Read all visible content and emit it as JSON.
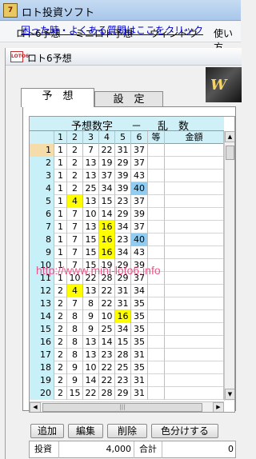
{
  "app": {
    "title": "ロト投資ソフト",
    "icon_text": "7"
  },
  "menu": [
    "ロト6予想",
    "ミニロト予想",
    "ウィンドウ",
    "使い方"
  ],
  "child": {
    "title": "ロト6予想",
    "icon_text": "LOTO6",
    "help_link": "困った時・よくある質問はここをクリック",
    "banner_text": "W"
  },
  "tabs": [
    "予　想",
    "設　定"
  ],
  "grid": {
    "title_left": "予想数字",
    "title_dash": "－",
    "title_right": "乱　数",
    "headers": [
      "1",
      "2",
      "3",
      "4",
      "5",
      "6",
      "等",
      "金額"
    ],
    "rows": [
      {
        "n": "1",
        "v": [
          "1",
          "2",
          "7",
          "22",
          "31",
          "37"
        ],
        "hl": [
          "",
          "",
          "",
          "",
          "",
          ""
        ]
      },
      {
        "n": "2",
        "v": [
          "1",
          "2",
          "13",
          "19",
          "29",
          "37"
        ],
        "hl": [
          "",
          "",
          "",
          "",
          "",
          ""
        ]
      },
      {
        "n": "3",
        "v": [
          "1",
          "2",
          "13",
          "37",
          "39",
          "43"
        ],
        "hl": [
          "",
          "",
          "",
          "",
          "",
          ""
        ]
      },
      {
        "n": "4",
        "v": [
          "1",
          "2",
          "25",
          "34",
          "39",
          "40"
        ],
        "hl": [
          "",
          "",
          "",
          "",
          "",
          "b"
        ]
      },
      {
        "n": "5",
        "v": [
          "1",
          "4",
          "13",
          "15",
          "23",
          "37"
        ],
        "hl": [
          "",
          "y",
          "",
          "",
          "",
          ""
        ]
      },
      {
        "n": "6",
        "v": [
          "1",
          "7",
          "10",
          "14",
          "29",
          "39"
        ],
        "hl": [
          "",
          "",
          "",
          "",
          "",
          ""
        ]
      },
      {
        "n": "7",
        "v": [
          "1",
          "7",
          "13",
          "16",
          "34",
          "37"
        ],
        "hl": [
          "",
          "",
          "",
          "y",
          "",
          ""
        ]
      },
      {
        "n": "8",
        "v": [
          "1",
          "7",
          "15",
          "16",
          "23",
          "40"
        ],
        "hl": [
          "",
          "",
          "",
          "y",
          "",
          "b"
        ]
      },
      {
        "n": "9",
        "v": [
          "1",
          "7",
          "15",
          "16",
          "34",
          "43"
        ],
        "hl": [
          "",
          "",
          "",
          "y",
          "",
          ""
        ]
      },
      {
        "n": "10",
        "v": [
          "1",
          "7",
          "15",
          "19",
          "29",
          "39"
        ],
        "hl": [
          "",
          "",
          "",
          "",
          "",
          ""
        ]
      },
      {
        "n": "11",
        "v": [
          "1",
          "10",
          "22",
          "28",
          "29",
          "37"
        ],
        "hl": [
          "",
          "",
          "",
          "",
          "",
          ""
        ]
      },
      {
        "n": "12",
        "v": [
          "2",
          "4",
          "13",
          "22",
          "31",
          "34"
        ],
        "hl": [
          "",
          "y",
          "",
          "",
          "",
          ""
        ]
      },
      {
        "n": "13",
        "v": [
          "2",
          "7",
          "8",
          "22",
          "31",
          "35"
        ],
        "hl": [
          "",
          "",
          "",
          "",
          "",
          ""
        ]
      },
      {
        "n": "14",
        "v": [
          "2",
          "8",
          "9",
          "10",
          "16",
          "35"
        ],
        "hl": [
          "",
          "",
          "",
          "",
          "y",
          ""
        ]
      },
      {
        "n": "15",
        "v": [
          "2",
          "8",
          "9",
          "25",
          "34",
          "35"
        ],
        "hl": [
          "",
          "",
          "",
          "",
          "",
          ""
        ]
      },
      {
        "n": "16",
        "v": [
          "2",
          "8",
          "13",
          "14",
          "15",
          "35"
        ],
        "hl": [
          "",
          "",
          "",
          "",
          "",
          ""
        ]
      },
      {
        "n": "17",
        "v": [
          "2",
          "8",
          "13",
          "23",
          "28",
          "31"
        ],
        "hl": [
          "",
          "",
          "",
          "",
          "",
          ""
        ]
      },
      {
        "n": "18",
        "v": [
          "2",
          "9",
          "10",
          "22",
          "25",
          "35"
        ],
        "hl": [
          "",
          "",
          "",
          "",
          "",
          ""
        ]
      },
      {
        "n": "19",
        "v": [
          "2",
          "9",
          "14",
          "22",
          "23",
          "31"
        ],
        "hl": [
          "",
          "",
          "",
          "",
          "",
          ""
        ]
      },
      {
        "n": "20",
        "v": [
          "2",
          "15",
          "22",
          "28",
          "29",
          "31"
        ],
        "hl": [
          "",
          "",
          "",
          "",
          "",
          ""
        ]
      }
    ]
  },
  "watermark": "http://www.mini-loto6.info",
  "buttons": [
    "追加",
    "編集",
    "削除",
    "色分けする"
  ],
  "footer": {
    "invest_label": "投資",
    "invest_value": "4,000",
    "total_label": "合計",
    "total_value": "0"
  },
  "colors": {
    "highlight_yellow": "#ffff00",
    "highlight_blue": "#8fcdf2",
    "header_cyan": "#d0f0f8",
    "selected_row": "#f6dca8"
  }
}
